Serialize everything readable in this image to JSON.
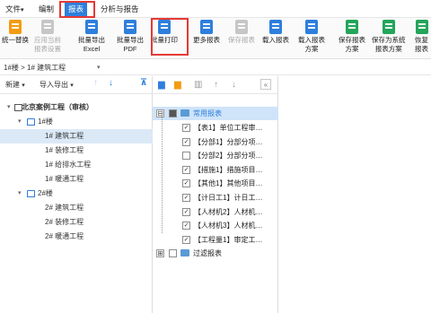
{
  "menubar": {
    "items": [
      {
        "label": "文件",
        "caret": "▾"
      },
      {
        "label": "编制"
      },
      {
        "label": "报表",
        "active": true
      },
      {
        "label": "分析与报告"
      }
    ]
  },
  "ribbon": {
    "buttons": [
      {
        "line1": "统一替换",
        "line2": "",
        "enabled": true,
        "icon": "replace-icon",
        "color": "orange"
      },
      {
        "line1": "应用当前",
        "line2": "报表设置",
        "enabled": false,
        "icon": "apply-settings-icon",
        "color": "gray"
      },
      {
        "line1": "批量导出",
        "line2": "Excel",
        "enabled": true,
        "icon": "excel-export-icon",
        "color": "blue"
      },
      {
        "line1": "批量导出",
        "line2": "PDF",
        "enabled": true,
        "icon": "pdf-export-icon",
        "color": "blue"
      },
      {
        "line1": "批量打印",
        "line2": "",
        "enabled": true,
        "icon": "print-icon",
        "color": "blue"
      },
      {
        "line1": "更多报表",
        "line2": "",
        "enabled": true,
        "icon": "more-reports-icon",
        "color": "blue"
      },
      {
        "line1": "保存报表",
        "line2": "",
        "enabled": false,
        "icon": "save-report-icon",
        "color": "gray"
      },
      {
        "line1": "载入报表",
        "line2": "",
        "enabled": true,
        "icon": "load-report-icon",
        "color": "blue"
      },
      {
        "line1": "载入报表",
        "line2": "方案",
        "enabled": true,
        "icon": "load-scheme-icon",
        "color": "blue"
      },
      {
        "line1": "保存报表",
        "line2": "方案",
        "enabled": true,
        "icon": "save-scheme-icon",
        "color": "green"
      },
      {
        "line1": "保存为系统",
        "line2": "报表方案",
        "enabled": true,
        "icon": "save-system-scheme-icon",
        "color": "green"
      },
      {
        "line1": "恢复",
        "line2": "报表",
        "enabled": true,
        "icon": "restore-icon",
        "color": "green"
      }
    ]
  },
  "breadcrumb": {
    "text": "1#楼 > 1# 建筑工程",
    "caret": "▾"
  },
  "left": {
    "new_label": "新建",
    "import_label": "导入导出",
    "caret": "▾",
    "up": "↑",
    "down": "↓",
    "pin": "⊼",
    "tree": [
      {
        "label": "北京案例工程（审核）",
        "toggle": "▾",
        "icon": "project",
        "bold": true
      },
      {
        "label": "1#楼",
        "toggle": "▾",
        "icon": "building"
      },
      {
        "label": "1# 建筑工程",
        "selected": true
      },
      {
        "label": "1# 装修工程"
      },
      {
        "label": "1# 给排水工程"
      },
      {
        "label": "1# 暖通工程"
      },
      {
        "label": "2#楼",
        "toggle": "▾",
        "icon": "building"
      },
      {
        "label": "2# 建筑工程"
      },
      {
        "label": "2# 装修工程"
      },
      {
        "label": "2# 暖通工程"
      }
    ]
  },
  "mid": {
    "collapse": "«",
    "group1": {
      "label": "常用报表",
      "expand": "⊟"
    },
    "reports": [
      {
        "label": "【表1】单位工程审…",
        "checked": true
      },
      {
        "label": "【分部1】分部分项…",
        "checked": true
      },
      {
        "label": "【分部2】分部分项…",
        "checked": false
      },
      {
        "label": "【措施1】措施项目…",
        "checked": true
      },
      {
        "label": "【其他1】其他项目…",
        "checked": true
      },
      {
        "label": "【计日工1】计日工…",
        "checked": true
      },
      {
        "label": "【人材机2】人材机…",
        "checked": true
      },
      {
        "label": "【人材机3】人材机…",
        "checked": true
      },
      {
        "label": "【工程量1】审定工…",
        "checked": true
      }
    ],
    "group2": {
      "label": "过滤报表",
      "expand": "⊞"
    },
    "check_mark": "✓"
  },
  "colors": {
    "accent": "#2e7fdc",
    "highlight": "#e53935",
    "selected": "#dbe9f7"
  }
}
